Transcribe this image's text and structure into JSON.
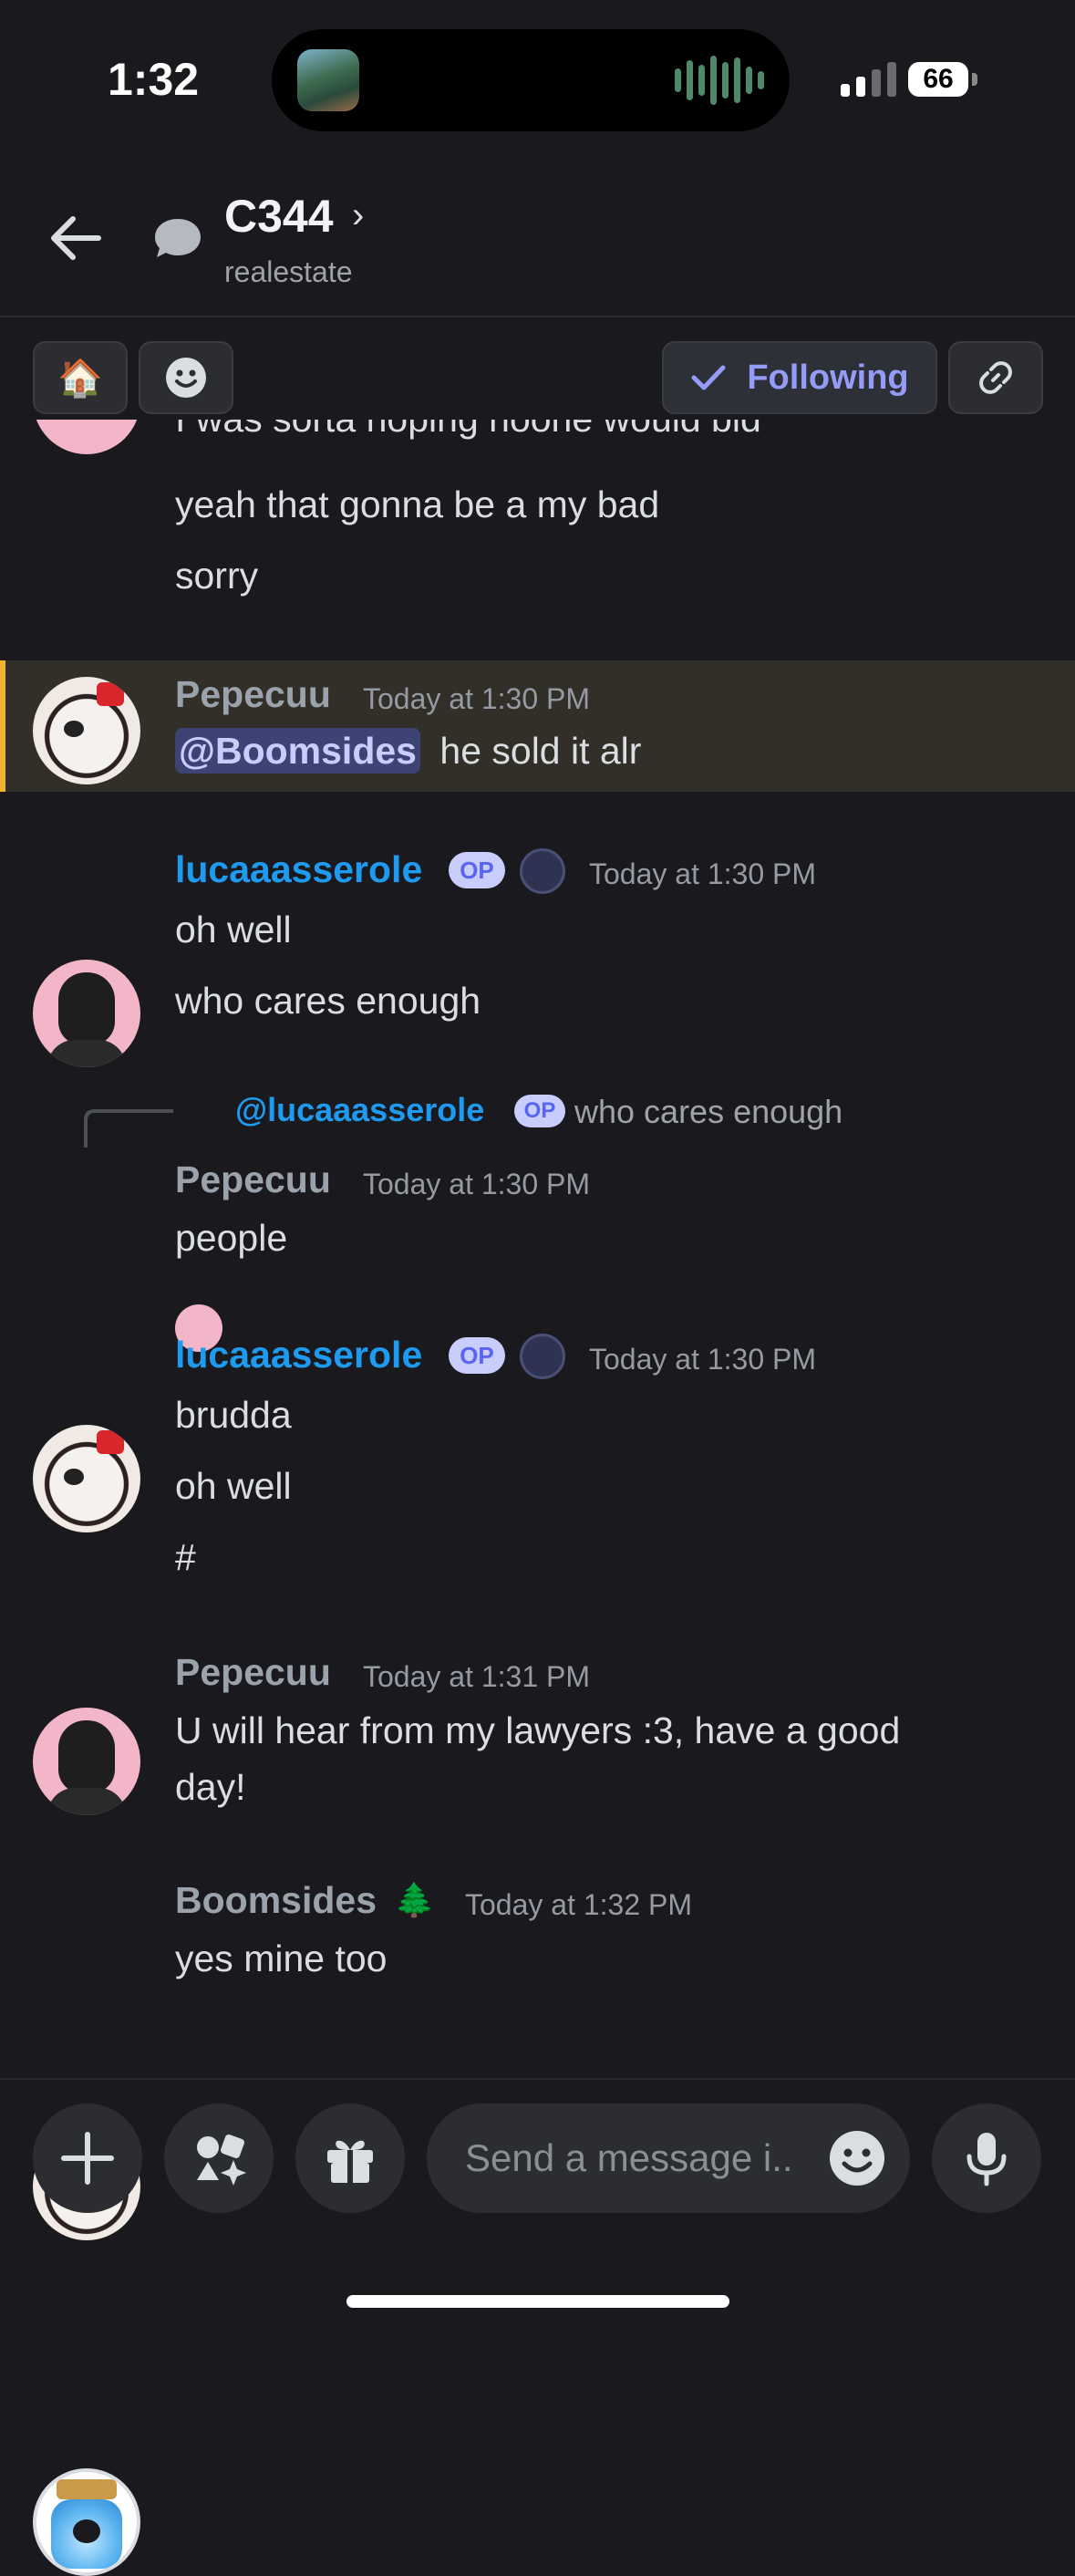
{
  "status": {
    "time": "1:32",
    "battery": "66"
  },
  "header": {
    "title": "C344",
    "chevron": "›",
    "subtitle": "realestate"
  },
  "toolbar": {
    "emoji_house": "🏠",
    "following": "Following"
  },
  "messages": [
    {
      "lines": [
        "I was sorta hoping noone would bid",
        "yeah that gonna be a my bad",
        "sorry"
      ]
    },
    {
      "user": "Pepecuu",
      "time": "Today at 1:30 PM",
      "mention": "@Boomsides",
      "text": "he sold it alr"
    },
    {
      "user": "lucaaasserole",
      "op": "OP",
      "time": "Today at 1:30 PM",
      "lines": [
        "oh well",
        "who cares enough"
      ]
    },
    {
      "reply": {
        "user": "@lucaaasserole",
        "op": "OP",
        "text": "who cares enough"
      },
      "user": "Pepecuu",
      "time": "Today at 1:30 PM",
      "text": "people"
    },
    {
      "user": "lucaaasserole",
      "op": "OP",
      "time": "Today at 1:30 PM",
      "lines": [
        "brudda",
        "oh well",
        "#"
      ]
    },
    {
      "user": "Pepecuu",
      "time": "Today at 1:31 PM",
      "lines": [
        "U will hear from my lawyers :3, have a good",
        "day!"
      ]
    },
    {
      "user": "Boomsides",
      "emoji": "🌲",
      "time": "Today at 1:32 PM",
      "text": "yes mine too"
    }
  ],
  "composer": {
    "placeholder": "Send a message i.."
  },
  "colors": {
    "background": "#1a1a1e",
    "op_blue": "#1e9bf0",
    "mention_highlight": "#322e28",
    "mention_bar": "#f0b232",
    "accent": "#949cf7"
  }
}
